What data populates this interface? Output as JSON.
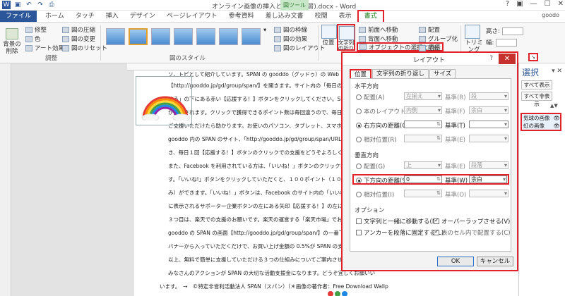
{
  "window": {
    "title": "オンライン画像の挿入と編集2(楽習).docx - Word",
    "context_group": "図ツール",
    "user": "goodo",
    "qat_icons": [
      "word-icon",
      "save-icon",
      "undo-icon",
      "redo-icon",
      "print-icon"
    ]
  },
  "tabs": [
    "ファイル",
    "ホーム",
    "タッチ",
    "挿入",
    "デザイン",
    "ページレイアウト",
    "参考資料",
    "差し込み文書",
    "校閲",
    "表示",
    "書式"
  ],
  "ribbon": {
    "remove_bg": "背景の削除",
    "adjust": {
      "corrections": "修整",
      "color": "色",
      "artistic": "アート効果",
      "compress": "図の圧縮",
      "change": "図の変更",
      "reset": "図のリセット",
      "label": "調整"
    },
    "styles": {
      "label": "図のスタイル",
      "border": "図の枠線",
      "effects": "図の効果",
      "layout": "図のレイアウト"
    },
    "arrange": {
      "position": "位置",
      "wrap": "文字列の折り返し",
      "forward": "前面へ移動",
      "backward": "背面へ移動",
      "selection": "オブジェクトの選択と表示",
      "align": "配置",
      "group": "グループ化",
      "rotate": "回転"
    },
    "size": {
      "crop": "トリミング",
      "height_label": "高さ:",
      "width_label": "幅:",
      "height": "",
      "width": ""
    }
  },
  "document": {
    "lines": [
      "【http://gooddo.jp/gd/group/span/】を開きます。サイト内の「毎日のクリックで",
      "する」の下にある赤い【応援する！】ボタンをクリックしてください。SPAN に応援ポイン",
      "が加算されます。クリックで獲得できるポイント数は毎回違うので、毎日１回、ゲーム感",
      "ご支援いただけたら助かります。お使いのパソコン、タブレット、スマホのブックマーク",
      "gooddo 内の SPAN のサイト、「http://gooddo.jp/gd/group/span/URL」を登録して",
      "き、毎日１回【応援する！】ボタンのクリックでの支援をどうぞよろしくお願いします。",
      "また、Facebook を利用されている方は、「いいね！」ボタンのクリックをよろしくお願",
      "す。「いいね!」ボタンをクリックしていただくと、１００ポイント（１０円）の支援（",
      "み）ができます。「いいね！」ボタンは、Facebook のサイト内の「いいね！で応援する",
      "に表示されるサポーター企業ボタンの左にある矢印【応援する！】の左にあります。",
      "３つ目は、楽天での支援のお願いです。楽天の運営する「楽天市場」でお買い物をする際",
      "gooddo の SPAN の画面【http://gooddo.jp/gd/group/span/】の一番下の「楽天市場",
      "バナーから入っていただくだけで、お買い上げ金額の 0.5%が SPAN の支援金になります",
      "以上、無料で簡単に支援していただける３つの仕組みについてご案内させていただきまし",
      "みなさんのアクションが SPAN の大切な活動支援金になります。どうぞ宜しくお願いい",
      "います。　→　©特定非営利活動法人 SPAN（スパン）（＊画像の著作者：Free Download Wallp"
    ],
    "header_partial": "ソ．トピとして紹介しています。SPAN の gooddo（グッドゥ）の Web"
  },
  "dialog": {
    "title": "レイアウト",
    "help": "?",
    "close": "✕",
    "tabs": [
      "位置",
      "文字列の折り返し",
      "サイズ"
    ],
    "horizontal": {
      "label": "水平方向",
      "rows": [
        {
          "label": "配置(A)",
          "value": "左揃え",
          "rel_label": "基準(R)",
          "rel_value": "段"
        },
        {
          "label": "本のレイアウト(B)",
          "value": "内側",
          "rel_label": "基準(F)",
          "rel_value": "余白"
        },
        {
          "label": "右方向の距離(O)",
          "value": "",
          "rel_label": "基準(T)",
          "rel_value": ""
        },
        {
          "label": "相対位置(R)",
          "value": "",
          "rel_label": "基準(E)",
          "rel_value": ""
        }
      ]
    },
    "vertical": {
      "label": "垂直方向",
      "rows": [
        {
          "label": "配置(G)",
          "value": "上",
          "rel_label": "基準(E)",
          "rel_value": "段落"
        },
        {
          "label": "下方向の距離(S)",
          "value": "0",
          "rel_label": "基準(W)",
          "rel_value": "余白"
        },
        {
          "label": "相対位置(I)",
          "value": "",
          "rel_label": "基準(O)",
          "rel_value": ""
        }
      ]
    },
    "options": {
      "label": "オプション",
      "move_with_text": "文字列と一緒に移動する(M)",
      "overlap": "オーバーラップさせる(V)",
      "anchor": "アンカーを段落に固定する(L)",
      "in_cell": "表のセル内で配置する(C)"
    },
    "ok": "OK",
    "cancel": "キャンセル"
  },
  "selection_pane": {
    "title": "選択",
    "show_all": "すべて表示",
    "hide_all": "すべて非表示",
    "items": [
      "気球の画像",
      "虹の画像"
    ]
  }
}
